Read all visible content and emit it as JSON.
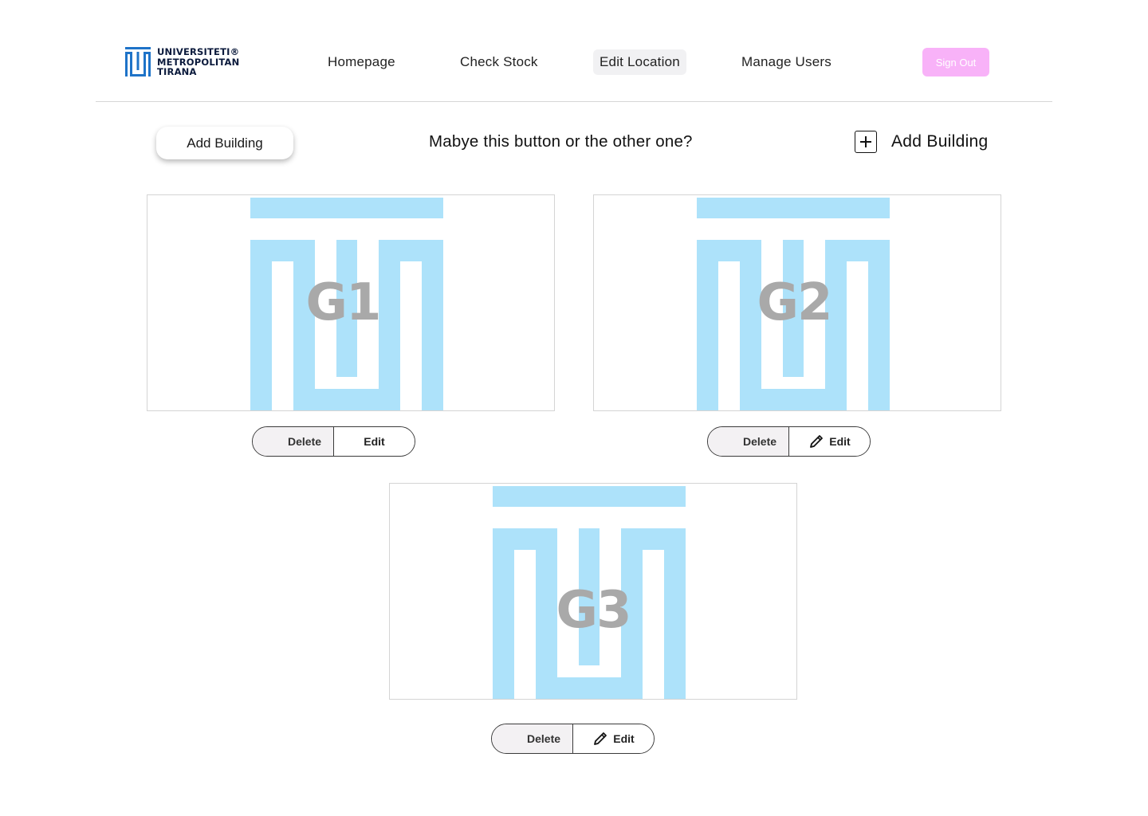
{
  "header": {
    "logo_lines": [
      "UNIVERSITETI®",
      "METROPOLITAN",
      "TIRANA"
    ],
    "nav": [
      {
        "label": "Homepage",
        "active": false
      },
      {
        "label": "Check Stock",
        "active": false
      },
      {
        "label": "Edit Location",
        "active": true
      },
      {
        "label": "Manage Users",
        "active": false
      }
    ],
    "signout_label": "Sign Out"
  },
  "toolbar": {
    "add_building_pill_label": "Add Building",
    "question": "Mabye this button or the other one?",
    "add_building_icon_label": "Add Building",
    "add_icon": "plus-square-icon"
  },
  "buildings": [
    {
      "label": "G1",
      "delete_label": "Delete",
      "edit_label": "Edit",
      "edit_has_icon": false
    },
    {
      "label": "G2",
      "delete_label": "Delete",
      "edit_label": "Edit",
      "edit_has_icon": true
    },
    {
      "label": "G3",
      "delete_label": "Delete",
      "edit_label": "Edit",
      "edit_has_icon": true
    }
  ],
  "colors": {
    "brand_blue": "#1e73c8",
    "art_blue": "#ade2fa",
    "signout_pink": "#f8b2f8",
    "active_nav_bg": "#f1f1f3"
  }
}
